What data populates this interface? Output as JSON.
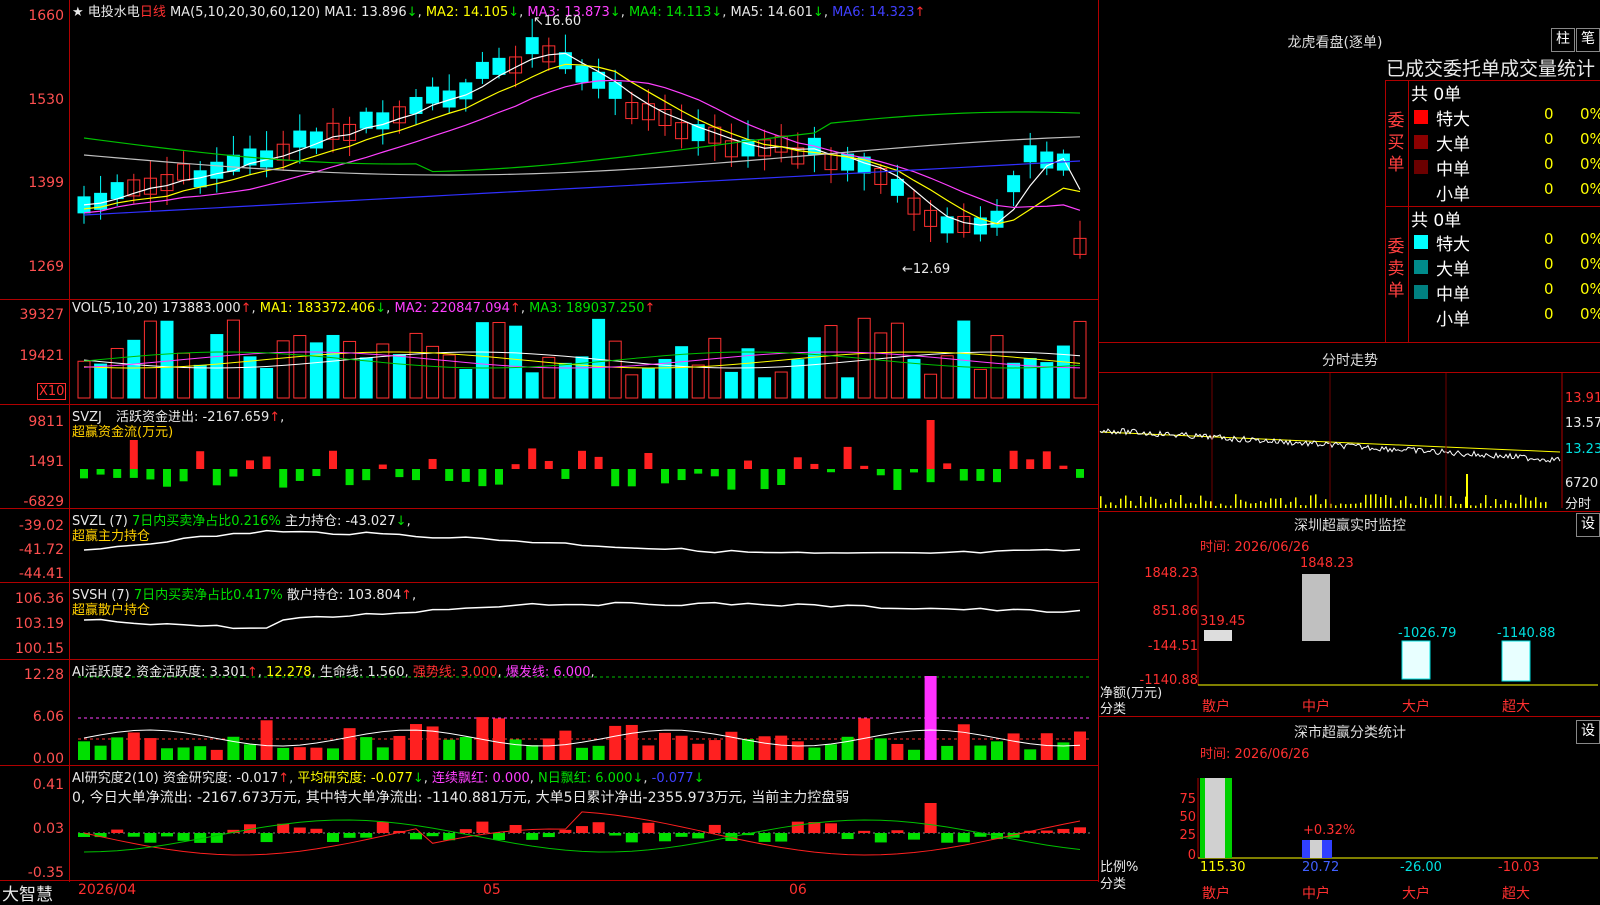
{
  "stock": {
    "name": "电投水电",
    "period": "日线",
    "star": "★"
  },
  "ma_header": {
    "label": "MA(5,10,20,30,60,120)",
    "ma1": "MA1: 13.896",
    "ma1_arrow": "↓",
    "ma2": "MA2: 14.105",
    "ma2_arrow": "↓",
    "ma3": "MA3: 13.873",
    "ma3_arrow": "↓",
    "ma4": "MA4: 14.113",
    "ma4_arrow": "↓",
    "ma5": "MA5: 14.601",
    "ma5_arrow": "↓",
    "ma6": "MA6: 14.323",
    "ma6_arrow": "↑"
  },
  "price_axis": [
    "1660",
    "1530",
    "1399",
    "1269"
  ],
  "price_high_label": "16.60",
  "price_low_label": "←12.69",
  "vol_header": {
    "label": "VOL(5,10,20)",
    "value": "173883.000",
    "v_arrow": "↑",
    "ma1": "MA1: 183372.406",
    "ma1_arrow": "↓",
    "ma2": "MA2: 220847.094",
    "ma2_arrow": "↑",
    "ma3": "MA3: 189037.250",
    "ma3_arrow": "↑"
  },
  "vol_axis": [
    "39327",
    "19421"
  ],
  "vol_unit": "X10",
  "svzj": {
    "label": "SVZJ",
    "text1": "活跃资金进出: -2167.659",
    "arrow": "↑",
    "tail": ",",
    "sub": "超赢资金流(万元)",
    "axis": [
      "9811",
      "1491",
      "-6829"
    ]
  },
  "svzl": {
    "label": "SVZL (7)",
    "text1": "7日内买卖净占比0.216%",
    "text2": "主力持仓: -43.027",
    "arrow": "↓",
    "tail": ",",
    "sub": "超赢主力持仓",
    "axis": [
      "-39.02",
      "-41.72",
      "-44.41"
    ]
  },
  "svsh": {
    "label": "SVSH (7)",
    "text1": "7日内买卖净占比0.417%",
    "text2": "散户持仓: 103.804",
    "arrow": "↑",
    "tail": ",",
    "sub": "超赢散户持仓",
    "axis": [
      "106.36",
      "103.19",
      "100.15"
    ]
  },
  "ai1": {
    "label": "AI活跃度2",
    "t1": "资金活跃度: 3.301",
    "a1": "↑",
    "t2": "12.278",
    "t3": "生命线: 1.560",
    "t4": "强势线: 3.000",
    "t5": "爆发线: 6.000",
    "axis": [
      "12.28",
      "6.06",
      "0.00"
    ]
  },
  "ai2": {
    "label": "AI研究度2(10)",
    "t1": "资金研究度: -0.017",
    "a1": "↑",
    "t2": "平均研究度: -0.077",
    "a2": "↓",
    "t3": "连续飘红: 0.000",
    "t4": "N日飘红: 6.000",
    "a4": "↓",
    "t5": "-0.077",
    "a5": "↓",
    "sentence": "0, 今日大单净流出: -2167.673万元, 其中特大单净流出: -1140.881万元, 大单5日累计净出-2355.973万元, 当前主力控盘弱",
    "axis": [
      "0.41",
      "0.03",
      "-0.35"
    ]
  },
  "date_axis": {
    "start": "2026/04",
    "m1": "05",
    "m2": "06"
  },
  "brand": "大智慧",
  "lhb": {
    "title": "龙虎看盘(逐单)",
    "btn1": "柱",
    "btn2": "笔",
    "subtitle": "已成交委托单成交量统计",
    "buy_vlabel": "委买单",
    "sell_vlabel": "委卖单",
    "buy_total": "共 0单",
    "sell_total": "共 0单",
    "buy_rows": [
      {
        "label": "特大",
        "count": "0",
        "pct": "0%",
        "color": "#ff0000"
      },
      {
        "label": "大单",
        "count": "0",
        "pct": "0%",
        "color": "#8b0000"
      },
      {
        "label": "中单",
        "count": "0",
        "pct": "0%",
        "color": "#6b0000"
      },
      {
        "label": "小单",
        "count": "0",
        "pct": "0%",
        "color": ""
      }
    ],
    "sell_rows": [
      {
        "label": "特大",
        "count": "0",
        "pct": "0%",
        "color": "#00ffff"
      },
      {
        "label": "大单",
        "count": "0",
        "pct": "0%",
        "color": "#008b8b"
      },
      {
        "label": "中单",
        "count": "0",
        "pct": "0%",
        "color": "#008080"
      },
      {
        "label": "小单",
        "count": "0",
        "pct": "0%",
        "color": ""
      }
    ]
  },
  "intraday": {
    "title": "分时走势",
    "axis": [
      "13.91",
      "13.57",
      "13.23",
      "6720"
    ],
    "axis_tail": "分时"
  },
  "sz_monitor": {
    "title": "深圳超赢实时监控",
    "btn": "设",
    "time": "时间: 2026/06/26",
    "axis": [
      "1848.23",
      "851.86",
      "-144.51",
      "-1140.88"
    ],
    "unit": "净额(万元)",
    "cat_label": "分类",
    "values": [
      "319.45",
      "1848.23",
      "-1026.79",
      "-1140.88"
    ],
    "cats": [
      "散户",
      "中户",
      "大户",
      "超大"
    ]
  },
  "sz_stats": {
    "title": "深市超赢分类统计",
    "btn": "设",
    "time": "时间: 2026/06/26",
    "axis": [
      "75",
      "50",
      "25",
      "0"
    ],
    "unit": "比例%",
    "cat_label": "分类",
    "top_label": "+0.32%",
    "values": [
      "115.30",
      "20.72",
      "-26.00",
      "-10.03"
    ],
    "cats": [
      "散户",
      "中户",
      "大户",
      "超大"
    ]
  }
}
